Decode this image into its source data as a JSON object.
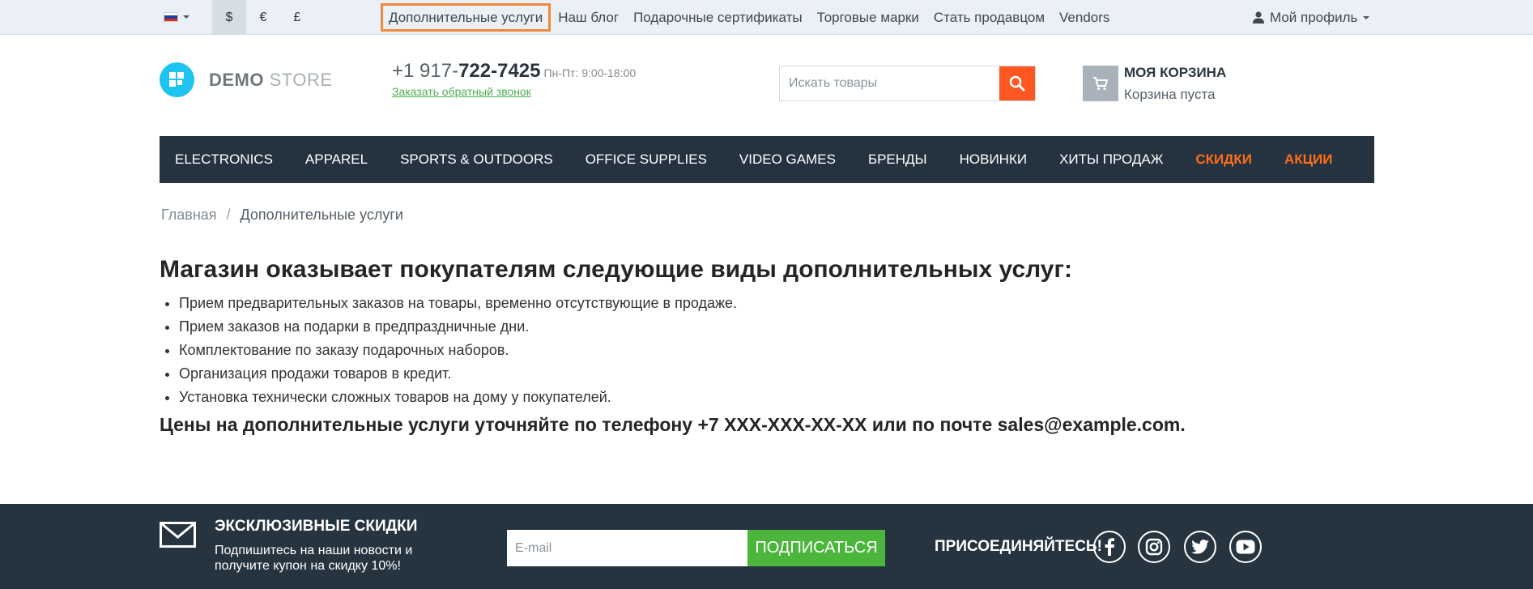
{
  "topbar": {
    "currencies": [
      "$",
      "€",
      "£"
    ],
    "links": [
      "Дополнительные услуги",
      "Наш блог",
      "Подарочные сертификаты",
      "Торговые марки",
      "Стать продавцом",
      "Vendors"
    ],
    "profile_label": "Мой профиль"
  },
  "header": {
    "logo_bold": "DEMO",
    "logo_light": " STORE",
    "phone_prefix": "+1 917-",
    "phone_main": "722-7425",
    "hours": "Пн-Пт: 9:00-18:00",
    "callback": "Заказать обратный звонок",
    "search_placeholder": "Искать товары",
    "cart_title": "МОЯ КОРЗИНА",
    "cart_status": "Корзина пуста"
  },
  "nav": [
    "ELECTRONICS",
    "APPAREL",
    "SPORTS & OUTDOORS",
    "OFFICE SUPPLIES",
    "VIDEO GAMES",
    "БРЕНДЫ",
    "НОВИНКИ",
    "ХИТЫ ПРОДАЖ",
    "СКИДКИ",
    "АКЦИИ"
  ],
  "breadcrumb": {
    "home": "Главная",
    "separator": "/",
    "current": "Дополнительные услуги"
  },
  "content": {
    "heading": "Магазин оказывает покупателям следующие виды дополнительных услуг:",
    "items": [
      "Прием предварительных заказов на товары, временно отсутствующие в продаже.",
      "Прием заказов на подарки в предпраздничные дни.",
      "Комплектование по заказу подарочных наборов.",
      "Организация продажи товаров в кредит.",
      "Установка технически сложных товаров на дому у покупателей."
    ],
    "prices_note": "Цены на дополнительные услуги уточняйте по телефону +7 XXX-XXX-XX-XX или по почте sales@example.com."
  },
  "footer": {
    "newsletter_title": "ЭКСКЛЮЗИВНЫЕ СКИДКИ",
    "newsletter_desc": "Подпишитесь на наши новости и получите купон на скидку 10%!",
    "email_placeholder": "E-mail",
    "subscribe_label": "ПОДПИСАТЬСЯ",
    "join_label": "ПРИСОЕДИНЯЙТЕСЬ!",
    "social_icons": [
      "facebook-icon",
      "instagram-icon",
      "twitter-icon",
      "youtube-icon"
    ]
  },
  "colors": {
    "accent_orange": "#ff5722",
    "nav_bg": "#253340",
    "nav_highlight": "#ff6d18",
    "subscribe_green": "#4bb53c",
    "logo_blue": "#1ec4ef"
  }
}
